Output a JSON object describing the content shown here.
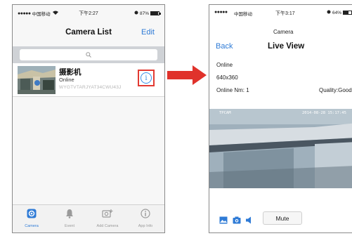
{
  "left_phone": {
    "status": {
      "carrier": "中国移动",
      "time": "下午2:27",
      "battery": "87%",
      "battery_level": 0.87
    },
    "nav": {
      "title": "Camera List",
      "edit_label": "Edit"
    },
    "camera": {
      "name": "摄影机",
      "status": "Online",
      "id": "WYGTVTARJYAT34CWU43J"
    },
    "tabs": [
      {
        "label": "Camera",
        "icon": "camera-tab-icon",
        "active": true
      },
      {
        "label": "Event",
        "icon": "bell-icon",
        "active": false
      },
      {
        "label": "Add Camera",
        "icon": "add-camera-icon",
        "active": false
      },
      {
        "label": "App Info",
        "icon": "info-icon",
        "active": false
      }
    ]
  },
  "right_phone": {
    "status": {
      "carrier": "中国移动",
      "time": "下午3:17",
      "battery": "64%",
      "battery_level": 0.64
    },
    "nav": {
      "subtitle": "Camera",
      "back_label": "Back",
      "title": "Live View"
    },
    "info": {
      "status": "Online",
      "resolution": "640x360",
      "online_num": "Online Nm: 1",
      "quality": "Quality:Good"
    },
    "video": {
      "overlay_left": "TPCAM",
      "overlay_right": "2014-08-28 15:17:45"
    },
    "controls": {
      "mute_label": "Mute"
    }
  },
  "colors": {
    "accent": "#2f7bd6",
    "highlight": "#e23a32",
    "arrow": "#e0322b"
  }
}
